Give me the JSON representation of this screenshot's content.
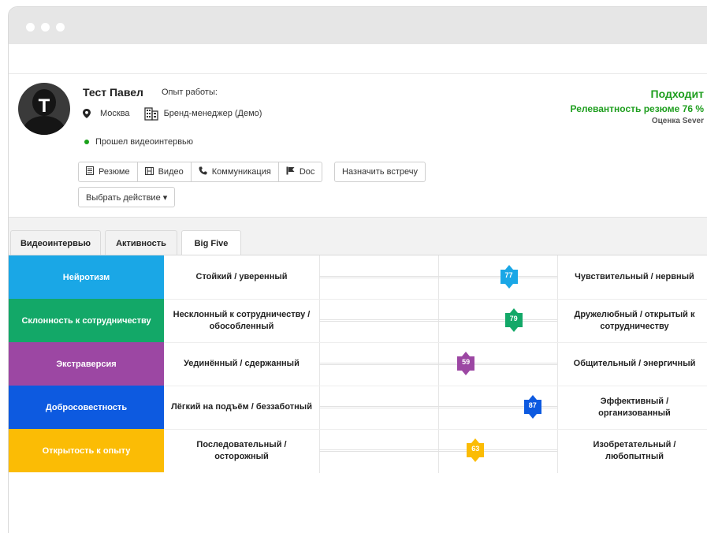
{
  "candidate": {
    "initial": "T",
    "name": "Тест Павел",
    "experience_label": "Опыт работы:",
    "city": "Москва",
    "position": "Бренд-менеджер (Демо)",
    "video_status": "Прошел видеоинтервью"
  },
  "verdict": {
    "status": "Подходит",
    "relevance": "Релевантность резюме 76 %",
    "assessment": "Оценка Sever"
  },
  "buttons": {
    "resume": "Резюме",
    "video": "Видео",
    "communication": "Коммуникация",
    "doc": "Doc",
    "schedule": "Назначить встречу",
    "action": "Выбрать действие ▾"
  },
  "tabs": [
    "Видеоинтервью",
    "Активность",
    "Big Five"
  ],
  "active_tab": "Big Five",
  "big_five": [
    {
      "trait": "Нейротизм",
      "low": "Стойкий / уверенный",
      "high": "Чувствительный / нервный",
      "score": 77,
      "color": "#1aa7e6"
    },
    {
      "trait": "Склонность к сотрудничеству",
      "low": "Несклонный к сотрудничеству / обособленный",
      "high": "Дружелюбный / открытый к сотрудничеству",
      "score": 79,
      "color": "#13a868"
    },
    {
      "trait": "Экстраверсия",
      "low": "Уединённый / сдержанный",
      "high": "Общительный / энергичный",
      "score": 59,
      "color": "#9c47a3"
    },
    {
      "trait": "Добросовестность",
      "low": "Лёгкий на подъём / беззаботный",
      "high": "Эффективный / организованный",
      "score": 87,
      "color": "#0d5ae0"
    },
    {
      "trait": "Открытость к опыту",
      "low": "Последовательный / осторожный",
      "high": "Изобретательный / любопытный",
      "score": 63,
      "color": "#fbbc05"
    }
  ]
}
